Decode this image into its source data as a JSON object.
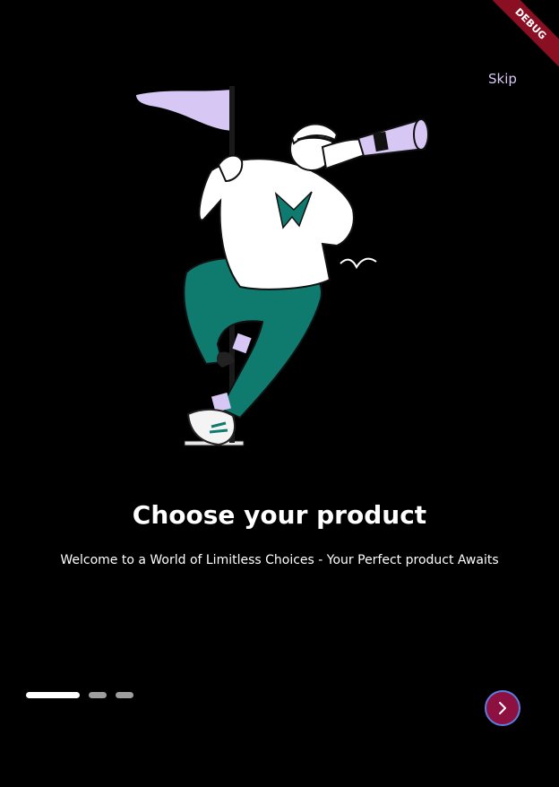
{
  "debug_banner": {
    "label": "DEBUG"
  },
  "skip": {
    "label": "Skip"
  },
  "onboarding": {
    "title": "Choose your product",
    "subtitle": "Welcome to a World of Limitless Choices - Your Perfect product Awaits"
  },
  "pagination": {
    "total": 3,
    "active_index": 0
  },
  "next_button": {
    "icon": "chevron-right-icon"
  },
  "colors": {
    "background": "#000000",
    "accent_lavender": "#d7c7f4",
    "accent_teal": "#0f7a6e",
    "next_button": "#8c1140",
    "next_button_border": "#5b7fe0",
    "debug_banner": "#8a0f22"
  }
}
